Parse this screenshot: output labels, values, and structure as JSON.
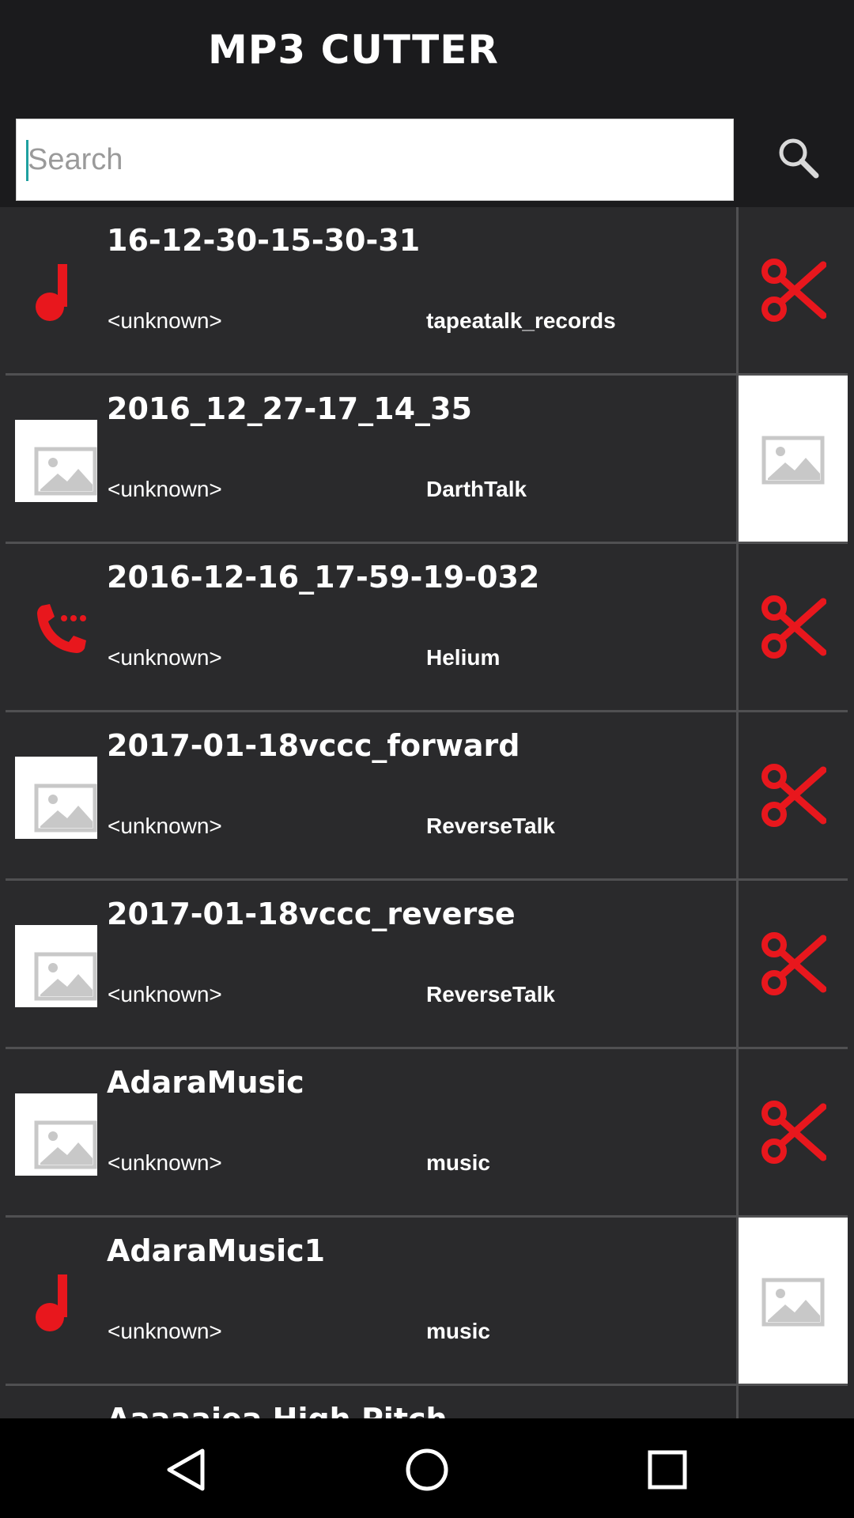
{
  "app": {
    "title": "MP3 CUTTER"
  },
  "search": {
    "placeholder": "Search",
    "value": ""
  },
  "songs": [
    {
      "name": "16-12-30-15-30-31",
      "artist": "<unknown>",
      "album": "tapeatalk_records",
      "thumb_icon": "music-note-icon",
      "action_icon": "scissors-icon"
    },
    {
      "name": "2016_12_27-17_14_35",
      "artist": "<unknown>",
      "album": "DarthTalk",
      "thumb_icon": "image-placeholder-icon",
      "action_icon": "album-art-placeholder-icon"
    },
    {
      "name": "2016-12-16_17-59-19-032",
      "artist": "<unknown>",
      "album": "Helium",
      "thumb_icon": "phone-call-icon",
      "action_icon": "scissors-icon"
    },
    {
      "name": "2017-01-18vccc_forward",
      "artist": "<unknown>",
      "album": "ReverseTalk",
      "thumb_icon": "image-placeholder-icon",
      "action_icon": "scissors-icon"
    },
    {
      "name": "2017-01-18vccc_reverse",
      "artist": "<unknown>",
      "album": "ReverseTalk",
      "thumb_icon": "image-placeholder-icon",
      "action_icon": "scissors-icon"
    },
    {
      "name": "AdaraMusic",
      "artist": "<unknown>",
      "album": "music",
      "thumb_icon": "image-placeholder-icon",
      "action_icon": "scissors-icon"
    },
    {
      "name": "AdaraMusic1",
      "artist": "<unknown>",
      "album": "music",
      "thumb_icon": "music-note-icon",
      "action_icon": "album-art-placeholder-icon"
    },
    {
      "name": "Aaaaaiea High Pitch",
      "artist": "",
      "album": "",
      "thumb_icon": "",
      "action_icon": ""
    }
  ],
  "colors": {
    "accent": "#e8171d",
    "background": "#2a2a2c",
    "appbar": "#1b1b1d"
  },
  "nav": {
    "back_icon": "back-triangle-icon",
    "home_icon": "home-circle-icon",
    "recents_icon": "recents-square-icon"
  }
}
